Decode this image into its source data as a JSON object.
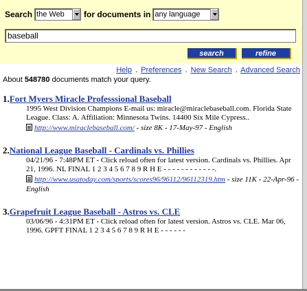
{
  "search": {
    "label_search": "Search",
    "scope_value": "the Web",
    "label_for": "for documents in",
    "language_value": "any language",
    "query_value": "baseball",
    "search_button": "search",
    "refine_button": "refine"
  },
  "links": {
    "help": "Help",
    "preferences": "Preferences",
    "new_search": "New Search",
    "advanced_search": "Advanced Search",
    "separator": "."
  },
  "summary": {
    "prefix": "About",
    "count": "548780",
    "suffix": "documents match your query."
  },
  "results": [
    {
      "number": "1.",
      "title": "Fort Myers Miracle Professsional Baseball",
      "snippet": "1995 West Division Champions E-mail us: miracle@miraclebaseball.com. Florida State League. Class: A. Affiliation: Minnesota Twins. 14400 Six Mile Cypress..",
      "url": "http://www.miraclebaseball.com/",
      "meta": " - size 8K - 17-May-97 - English"
    },
    {
      "number": "2.",
      "title": "National League Baseball - Cardinals vs. Phillies",
      "snippet": "04/21/96 - 7:48PM ET - Click reload often for latest version. Cardinals vs. Phillies. Apr 21, 1996. NL FINAL 1 2 3 4 5 6 7 8 9 R H E - - - - - - - - - - - -.",
      "url": "http://www.usatoday.com/sports/scores96/96112/96112319.htm",
      "meta": " - size 11K - 22-Apr-96 - English"
    },
    {
      "number": "3.",
      "title": "Grapefruit League Baseball - Astros vs. CLE",
      "snippet": "03/06/96 - 4:31PM ET - Click reload often for latest version. Astros vs. CLE. Mar 06, 1996. GPFT FINAL 1 2 3 4 5 6 7 8 9 R H E - - - - - -",
      "url": "",
      "meta": ""
    }
  ]
}
